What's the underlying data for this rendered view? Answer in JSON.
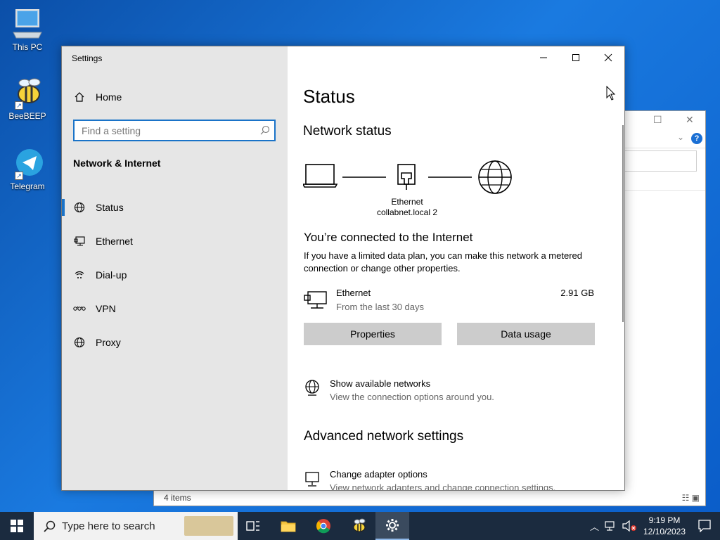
{
  "desktop": {
    "icons": [
      {
        "label": "This PC"
      },
      {
        "label": "BeeBEEP"
      },
      {
        "label": "Telegram"
      }
    ]
  },
  "explorer": {
    "status": "4 items"
  },
  "settings": {
    "window_title": "Settings",
    "sidebar": {
      "home_label": "Home",
      "search_placeholder": "Find a setting",
      "section_title": "Network & Internet",
      "items": [
        {
          "label": "Status",
          "icon": "globe-status-icon",
          "active": true
        },
        {
          "label": "Ethernet",
          "icon": "ethernet-icon",
          "active": false
        },
        {
          "label": "Dial-up",
          "icon": "dial-up-icon",
          "active": false
        },
        {
          "label": "VPN",
          "icon": "vpn-icon",
          "active": false
        },
        {
          "label": "Proxy",
          "icon": "globe-icon",
          "active": false
        }
      ]
    },
    "main": {
      "page_title": "Status",
      "network_status_heading": "Network status",
      "diagram": {
        "adapter_name": "Ethernet",
        "network_name": "collabnet.local 2"
      },
      "connected_title": "You’re connected to the Internet",
      "connected_desc": "If you have a limited data plan, you can make this network a metered connection or change other properties.",
      "adapter": {
        "name": "Ethernet",
        "subtitle": "From the last 30 days",
        "usage": "2.91 GB"
      },
      "buttons": {
        "properties": "Properties",
        "data_usage": "Data usage"
      },
      "show_networks": {
        "title": "Show available networks",
        "subtitle": "View the connection options around you."
      },
      "advanced_heading": "Advanced network settings",
      "adapter_options": {
        "title": "Change adapter options",
        "subtitle": "View network adapters and change connection settings."
      }
    }
  },
  "taskbar": {
    "search_text": "Type here to search",
    "clock_time": "9:19 PM",
    "clock_date": "12/10/2023"
  },
  "colors": {
    "accent": "#1a73c8",
    "sidebar_bg": "#e6e6e6",
    "taskbar_bg": "#1b2b3f"
  }
}
